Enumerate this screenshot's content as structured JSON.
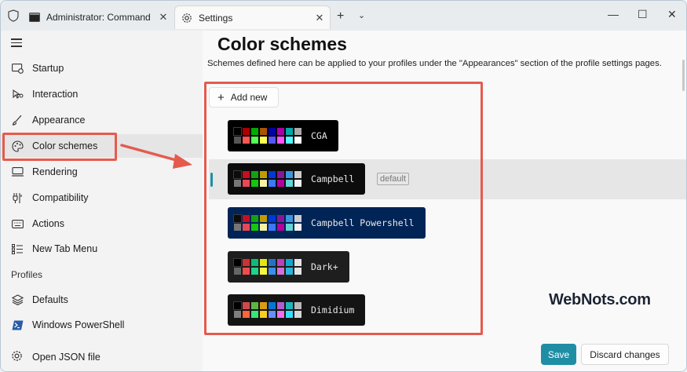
{
  "titlebar": {
    "tabs": [
      {
        "label": "Administrator: Command Pr",
        "icon": "terminal-icon"
      },
      {
        "label": "Settings",
        "icon": "gear-icon"
      }
    ],
    "close_glyph": "✕",
    "new_tab_glyph": "+",
    "dropdown_glyph": "⌄",
    "minimize_glyph": "—",
    "maximize_glyph": "☐",
    "window_close_glyph": "✕"
  },
  "sidebar": {
    "items": [
      {
        "label": "Startup",
        "icon": "startup-icon"
      },
      {
        "label": "Interaction",
        "icon": "interaction-icon"
      },
      {
        "label": "Appearance",
        "icon": "brush-icon"
      },
      {
        "label": "Color schemes",
        "icon": "palette-icon"
      },
      {
        "label": "Rendering",
        "icon": "monitor-icon"
      },
      {
        "label": "Compatibility",
        "icon": "compatibility-icon"
      },
      {
        "label": "Actions",
        "icon": "keyboard-icon"
      },
      {
        "label": "New Tab Menu",
        "icon": "list-icon"
      }
    ],
    "profiles_header": "Profiles",
    "profile_items": [
      {
        "label": "Defaults",
        "icon": "layers-icon"
      },
      {
        "label": "Windows PowerShell",
        "icon": "powershell-icon"
      }
    ],
    "footer_label": "Open JSON file"
  },
  "main": {
    "title": "Color schemes",
    "description": "Schemes defined here can be applied to your profiles under the \"Appearances\" section of the profile settings pages.",
    "add_label": "Add new",
    "default_badge": "default",
    "schemes": [
      {
        "name": "CGA",
        "bg": "#000000",
        "colors": [
          "#000000",
          "#aa0000",
          "#00aa00",
          "#aa5500",
          "#0000aa",
          "#aa00aa",
          "#00aaaa",
          "#aaaaaa",
          "#555555",
          "#ff5555",
          "#55ff55",
          "#ffff55",
          "#5555ff",
          "#ff55ff",
          "#55ffff",
          "#ffffff"
        ]
      },
      {
        "name": "Campbell",
        "bg": "#0c0c0c",
        "colors": [
          "#0c0c0c",
          "#c50f1f",
          "#13a10e",
          "#c19c00",
          "#0037da",
          "#881798",
          "#3a96dd",
          "#cccccc",
          "#767676",
          "#e74856",
          "#16c60c",
          "#f9f1a5",
          "#3b78ff",
          "#b4009e",
          "#61d6d6",
          "#f2f2f2"
        ]
      },
      {
        "name": "Campbell Powershell",
        "bg": "#012456",
        "colors": [
          "#0c0c0c",
          "#c50f1f",
          "#13a10e",
          "#c19c00",
          "#0037da",
          "#881798",
          "#3a96dd",
          "#cccccc",
          "#767676",
          "#e74856",
          "#16c60c",
          "#f9f1a5",
          "#3b78ff",
          "#b4009e",
          "#61d6d6",
          "#f2f2f2"
        ]
      },
      {
        "name": "Dark+",
        "bg": "#1e1e1e",
        "colors": [
          "#000000",
          "#cd3131",
          "#0dbc79",
          "#e5e510",
          "#2472c8",
          "#bc3fbc",
          "#11a8cd",
          "#e5e5e5",
          "#666666",
          "#f14c4c",
          "#23d18b",
          "#f5f543",
          "#3b8eea",
          "#d670d6",
          "#29b8db",
          "#e5e5e5"
        ]
      },
      {
        "name": "Dimidium",
        "bg": "#141414",
        "colors": [
          "#000000",
          "#cf494c",
          "#60b442",
          "#db9c11",
          "#0575d8",
          "#af5ed2",
          "#1db6bb",
          "#bab7b6",
          "#817e7e",
          "#ff643b",
          "#37e57b",
          "#fccd1a",
          "#688dfd",
          "#ed6fe9",
          "#32e0fb",
          "#d3d8d9"
        ]
      }
    ]
  },
  "footer": {
    "save_label": "Save",
    "discard_label": "Discard changes"
  },
  "watermark": "WebNots.com",
  "colors": {
    "accent": "#1f8ea5",
    "annotation": "#e45b4d"
  }
}
